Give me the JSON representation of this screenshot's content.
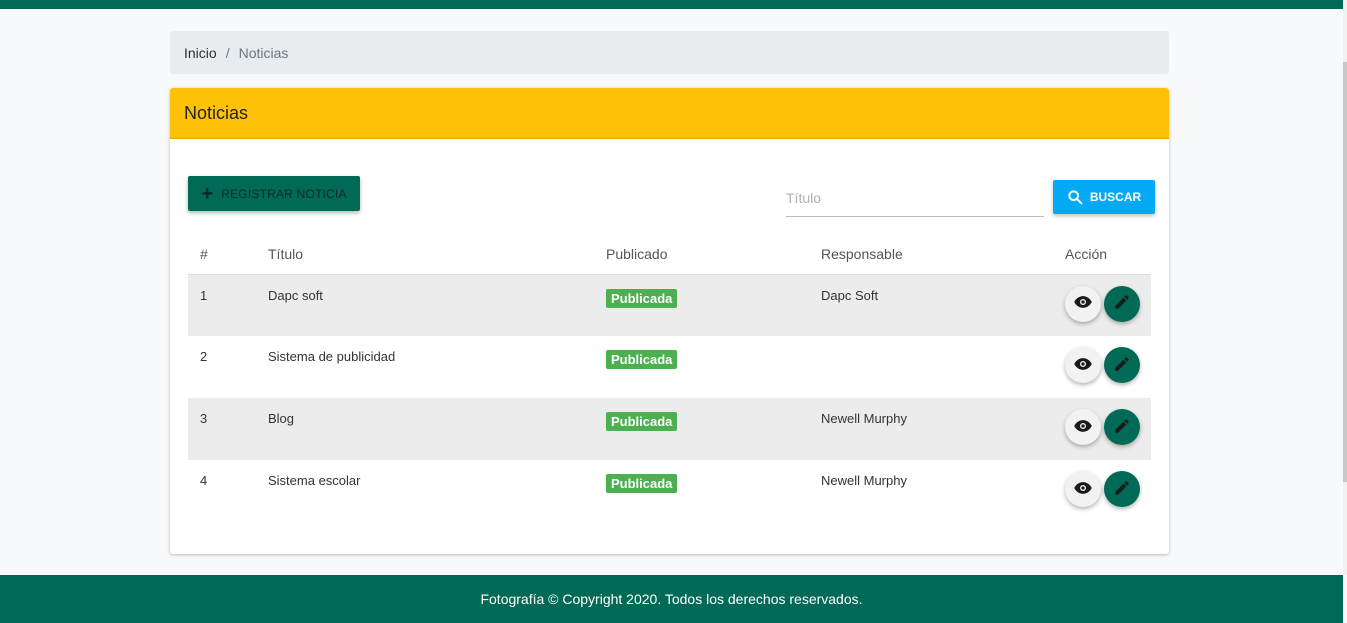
{
  "colors": {
    "brand": "#006a56",
    "header": "#ffc107",
    "search": "#03a9f4",
    "badge": "#4caf50"
  },
  "breadcrumb": {
    "home": "Inicio",
    "separator": "/",
    "current": "Noticias"
  },
  "card": {
    "title": "Noticias"
  },
  "toolbar": {
    "register_label": "REGISTRAR NOTICIA",
    "register_icon": "plus-icon",
    "search_placeholder": "Título",
    "search_value": "",
    "search_label": "BUSCAR",
    "search_icon": "search-icon"
  },
  "table": {
    "headers": [
      "#",
      "Título",
      "Publicado",
      "Responsable",
      "Acción"
    ],
    "rows": [
      {
        "num": "1",
        "title": "Dapc soft",
        "status": "Publicada",
        "responsible": "Dapc Soft"
      },
      {
        "num": "2",
        "title": "Sistema de publicidad",
        "status": "Publicada",
        "responsible": ""
      },
      {
        "num": "3",
        "title": "Blog",
        "status": "Publicada",
        "responsible": "Newell Murphy"
      },
      {
        "num": "4",
        "title": "Sistema escolar",
        "status": "Publicada",
        "responsible": "Newell Murphy"
      }
    ],
    "actions": {
      "view_icon": "eye-icon",
      "edit_icon": "pencil-icon"
    }
  },
  "footer": {
    "text": "Fotografía © Copyright 2020. Todos los derechos reservados."
  }
}
